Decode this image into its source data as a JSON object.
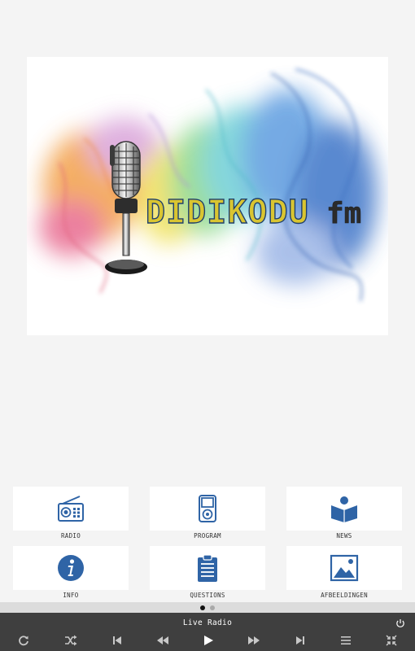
{
  "logo": {
    "station_name": "DIDIKODU",
    "suffix": "fm"
  },
  "menu": {
    "tiles": [
      {
        "label": "RADIO",
        "icon": "radio-icon"
      },
      {
        "label": "PROGRAM",
        "icon": "ipod-icon"
      },
      {
        "label": "NEWS",
        "icon": "reader-icon"
      },
      {
        "label": "INFO",
        "icon": "info-icon"
      },
      {
        "label": "QUESTIONS",
        "icon": "clipboard-icon"
      },
      {
        "label": "AFBEELDINGEN",
        "icon": "image-icon"
      }
    ]
  },
  "pager": {
    "pages": 2,
    "active_page": 1
  },
  "player": {
    "title": "Live Radio",
    "controls": [
      "refresh-icon",
      "shuffle-icon",
      "skip-back-icon",
      "rewind-icon",
      "play-icon",
      "fast-forward-icon",
      "skip-forward-icon",
      "playlist-icon",
      "collapse-icon"
    ],
    "power_icon": "power-icon"
  },
  "colors": {
    "accent": "#2f64a6",
    "player_bg": "#3f3f3f",
    "page_bg": "#f4f4f4"
  }
}
